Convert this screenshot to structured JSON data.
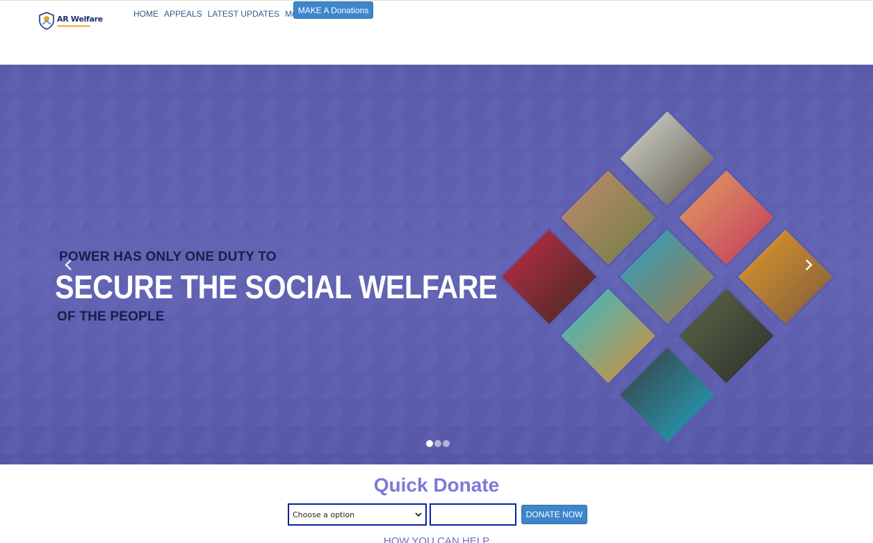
{
  "brand": {
    "logo_text": "AR Welfare",
    "logo_tagline": "",
    "colors": {
      "primary_blue": "#3d86cb",
      "hero_bg": "#5b5cad",
      "quick_title": "#7a7ad8",
      "field_border": "#0a1f9f"
    }
  },
  "nav": {
    "items": [
      "HOME",
      "APPEALS",
      "LATEST UPDATES"
    ],
    "more_label": "More",
    "cta_label": "MAKE A Donations"
  },
  "hero": {
    "line1": "POWER HAS ONLY ONE DUTY TO",
    "line2": "SECURE THE SOCIAL WELFARE",
    "line3": "OF THE PEOPLE",
    "prev_icon": "chevron-left-icon",
    "next_icon": "chevron-right-icon",
    "slide_count": 3,
    "active_slide": 1
  },
  "quick_donate": {
    "title": "Quick Donate",
    "select_value": "Choose a option",
    "amount_value": "",
    "submit_label": "DONATE NOW"
  },
  "next_section": {
    "title": "HOW YOU CAN HELP"
  }
}
